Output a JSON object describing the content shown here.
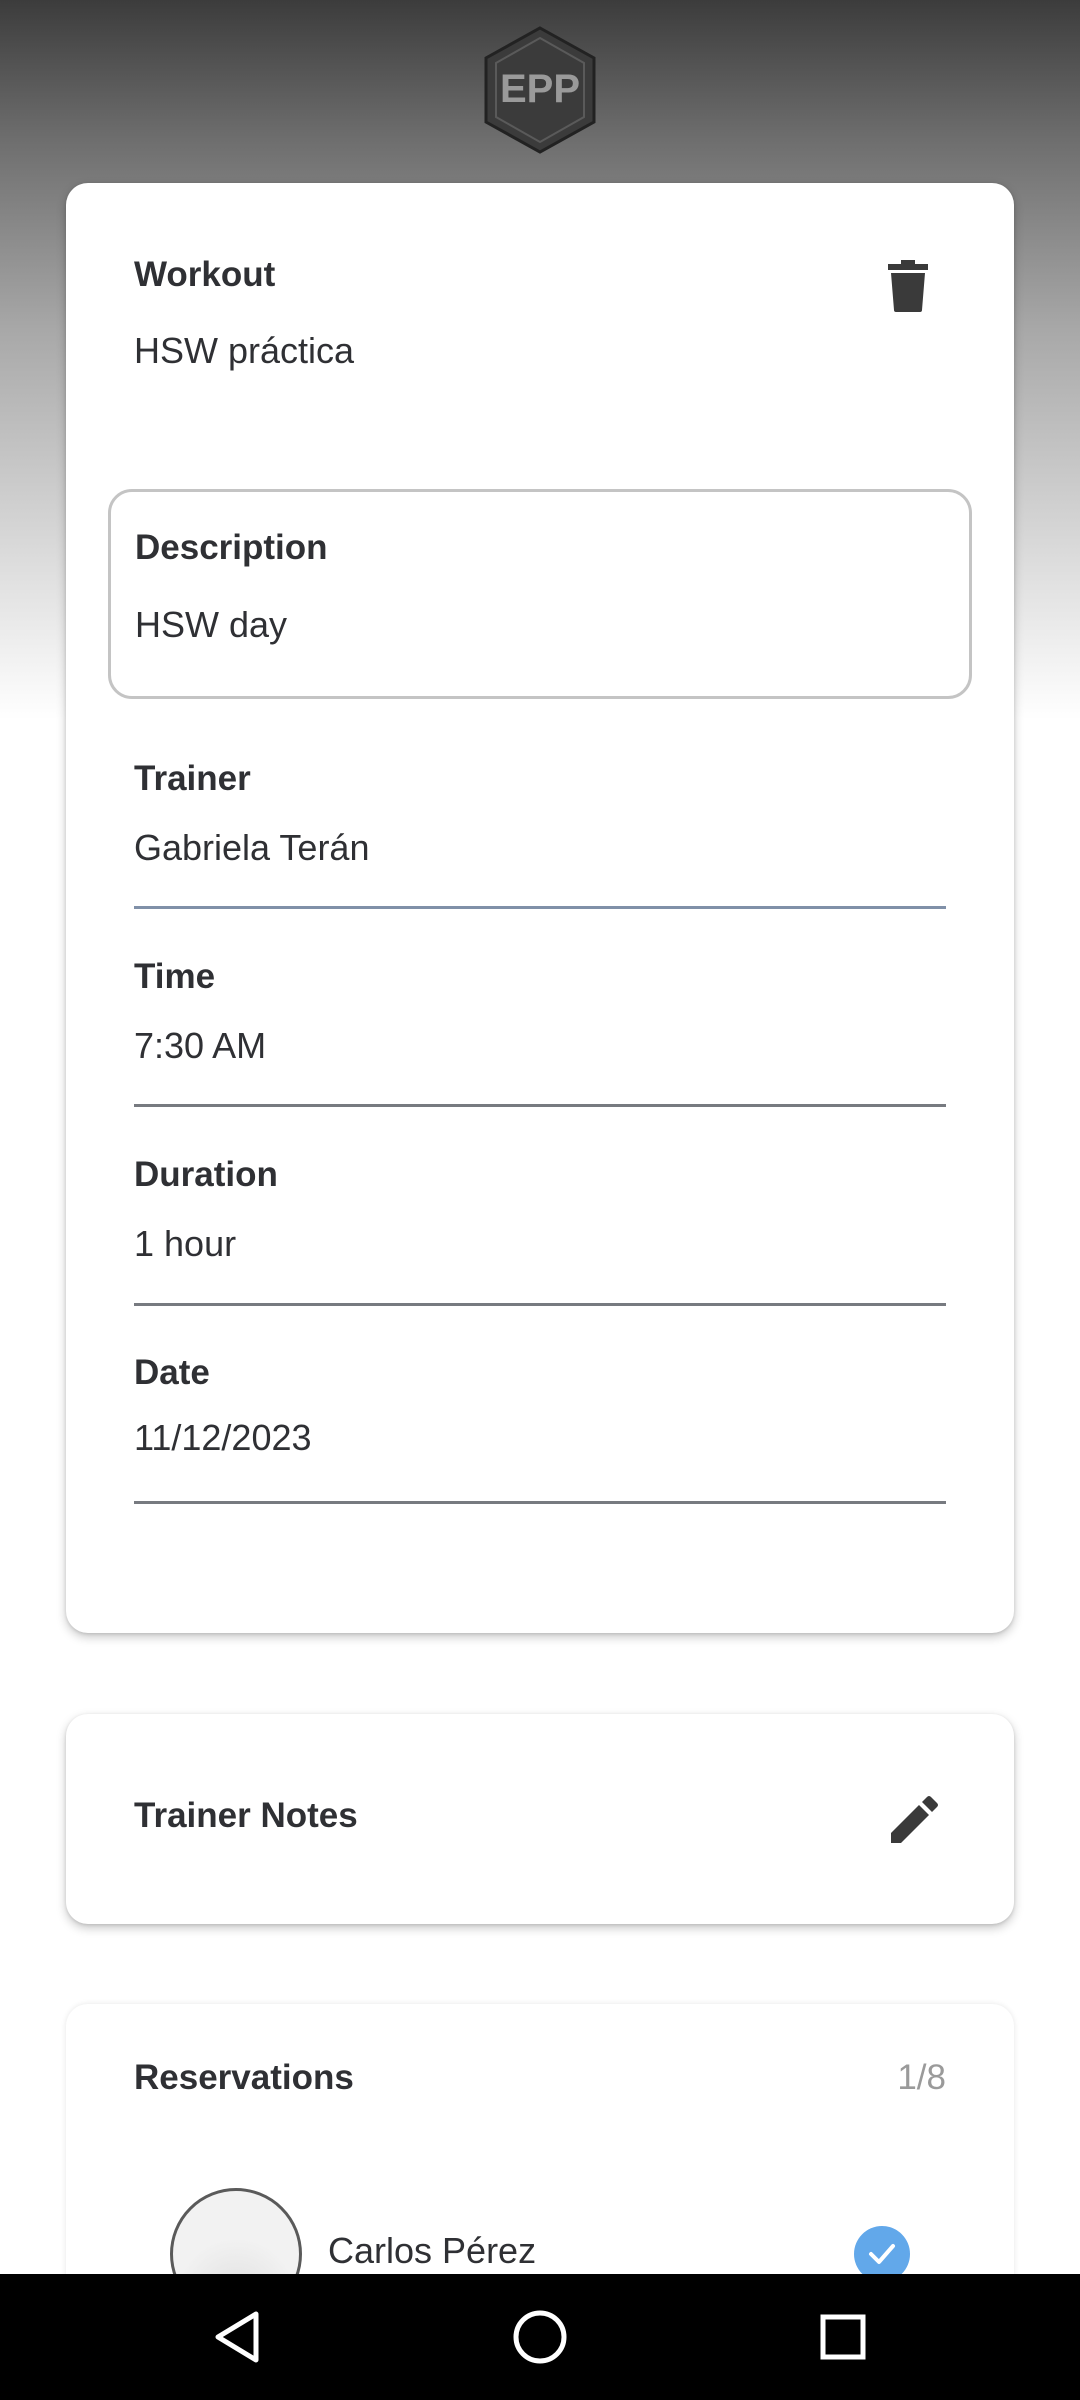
{
  "header": {
    "logo_text": "EPP",
    "logo_icon": "epp-hexagon-logo"
  },
  "workout_card": {
    "workout": {
      "label": "Workout",
      "value": "HSW práctica"
    },
    "description": {
      "label": "Description",
      "value": "HSW day"
    },
    "trainer": {
      "label": "Trainer",
      "value": "Gabriela Terán"
    },
    "time": {
      "label": "Time",
      "value": "7:30 AM"
    },
    "duration": {
      "label": "Duration",
      "value": "1 hour"
    },
    "date": {
      "label": "Date",
      "value": "11/12/2023"
    },
    "delete_icon": "trash-icon"
  },
  "notes_card": {
    "title": "Trainer Notes",
    "edit_icon": "pencil-icon"
  },
  "reservations_card": {
    "title": "Reservations",
    "count": "1/8",
    "items": [
      {
        "name": "Carlos Pérez",
        "checked": true
      }
    ]
  },
  "navbar": {
    "back_icon": "back-triangle-icon",
    "home_icon": "home-circle-icon",
    "recents_icon": "recents-square-icon"
  },
  "colors": {
    "accent_check": "#62a8ea",
    "text": "#2f3034",
    "muted": "#9a9a9a"
  }
}
